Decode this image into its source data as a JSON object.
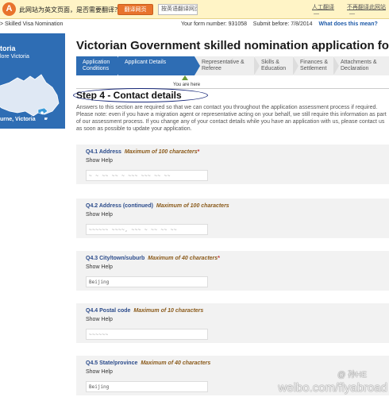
{
  "translate_bar": {
    "message": "此网站为英文页面，是否需要翻译？",
    "translate_button": "翻译网页",
    "select_value": "按英语翻译网页",
    "link_manual": "人工翻译",
    "link_never": "不再翻译此网站",
    "link_3": "—",
    "link_4": "—"
  },
  "breadcrumb": "> Skilled Visa Nomination",
  "form_info": {
    "form_number": "Your form number: 931058",
    "submit_before": "Submit before: 7/8/2014",
    "what_link": "What does this mean?"
  },
  "left_panel": {
    "title": "toria",
    "subtitle": "lore Victoria",
    "label": "urne, Victoria"
  },
  "page_title": "Victorian Government skilled nomination application form",
  "steps": [
    {
      "label": "Application\nConditions",
      "state": "done"
    },
    {
      "label": "Applicant Details",
      "state": "active"
    },
    {
      "label": "Representative &\nReferee",
      "state": "todo"
    },
    {
      "label": "Skills &\nEducation",
      "state": "todo"
    },
    {
      "label": "Finances &\nSettlement",
      "state": "todo"
    },
    {
      "label": "Attachments &\nDeclaration",
      "state": "todo"
    }
  ],
  "you_are_here": "You are here",
  "step_heading": "Step 4 - Contact details",
  "intro": "Answers to this section are required so that we can contact you throughout the application assessment process if required. Please note: even if you have a migration agent or representative acting on your behalf, we still require this information as part of our assessment process. If you change any of your contact details while you have an application with us, please contact us as soon as possible to update your application.",
  "questions": [
    {
      "label": "Q4.1 Address",
      "max": "Maximum of 100 characters",
      "required": "*",
      "help": "Show Help",
      "value": "~ ~ ~~ ~~ ~ ~~~ ~~~ ~~ ~~"
    },
    {
      "label": "Q4.2 Address (continued)",
      "max": "Maximum of 100 characters",
      "required": "",
      "help": "Show Help",
      "value": "~~~~~~ ~~~~, ~~~ ~ ~~ ~~ ~~"
    },
    {
      "label": "Q4.3 City/town/suburb",
      "max": "Maximum of 40 characters",
      "required": "*",
      "help": "Show Help",
      "value": "Beijing"
    },
    {
      "label": "Q4.4 Postal code",
      "max": "Maximum of 10 characters",
      "required": "",
      "help": "Show Help",
      "value": "~~~~~~"
    },
    {
      "label": "Q4.5 State/province",
      "max": "Maximum of 40 characters",
      "required": "",
      "help": "Show Help",
      "value": "Beijing"
    }
  ],
  "watermark": {
    "line1": "@ 孙HE",
    "line2": "weibo.com/flyabroad"
  },
  "colors": {
    "step_active": "#2e6db4",
    "step_todo": "#eeeeee",
    "question_bg": "#f2f2f2",
    "label_blue": "#2b4b8b",
    "max_brown": "#8a5a1a",
    "translate_orange": "#e8732c"
  }
}
